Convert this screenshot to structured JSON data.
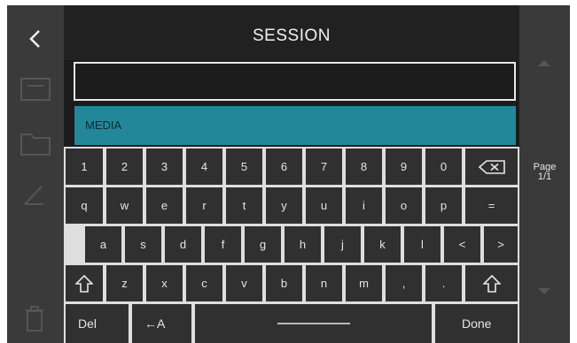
{
  "header": {
    "title": "SESSION"
  },
  "input": {
    "value": ""
  },
  "suggestion": {
    "label": "MEDIA"
  },
  "keyboard": {
    "row1": [
      "1",
      "2",
      "3",
      "4",
      "5",
      "6",
      "7",
      "8",
      "9",
      "0"
    ],
    "row2": [
      "q",
      "w",
      "e",
      "r",
      "t",
      "y",
      "u",
      "i",
      "o",
      "p",
      "="
    ],
    "row3": [
      "a",
      "s",
      "d",
      "f",
      "g",
      "h",
      "j",
      "k",
      "l",
      "<",
      ">"
    ],
    "row4": [
      "z",
      "x",
      "c",
      "v",
      "b",
      "n",
      "m",
      ",",
      "."
    ],
    "del_label": "Del",
    "case_label": "←A",
    "done_label": "Done"
  },
  "pager": {
    "title": "Page",
    "value": "1/1"
  },
  "icons": {
    "back": "chevron-left-icon",
    "backspace": "backspace-icon",
    "shift": "shift-icon",
    "space": "space-icon",
    "rail": [
      "document-icon",
      "folder-icon",
      "pencil-icon",
      "trash-icon"
    ],
    "page_up": "triangle-up-icon",
    "page_down": "triangle-down-icon"
  },
  "colors": {
    "background": "#1c1c1c",
    "rail": "#3a3a3a",
    "accent": "#23879a",
    "key": "#303030"
  }
}
